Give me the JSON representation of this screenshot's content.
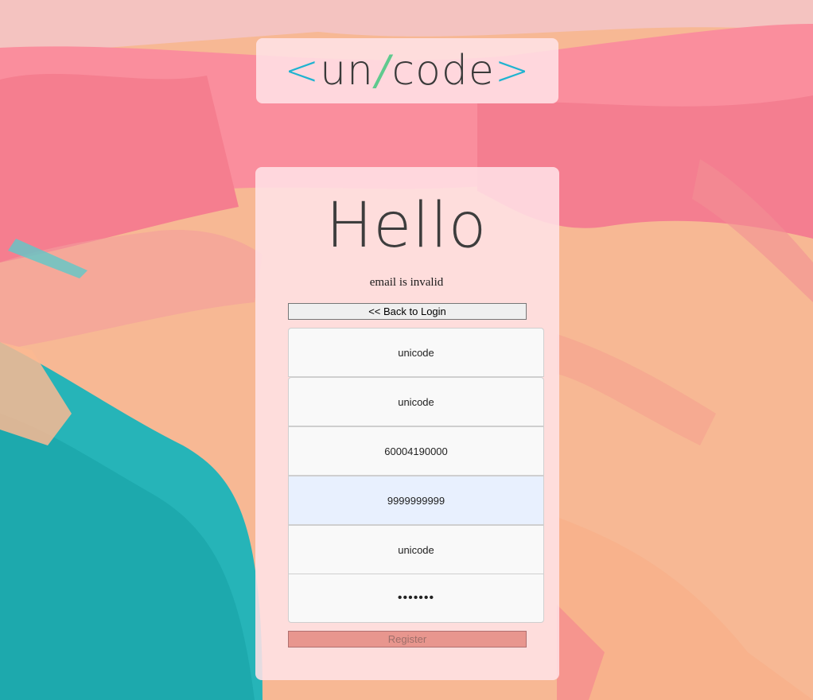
{
  "logo": {
    "open_bracket": "<",
    "text_before": "un",
    "slash": "/",
    "text_after": "code",
    "close_bracket": ">"
  },
  "heading": "Hello",
  "error_message": "email is invalid",
  "back_button_label": "<< Back to Login",
  "form": {
    "fields": [
      {
        "name": "field-1",
        "value": "unicode"
      },
      {
        "name": "field-2",
        "value": "unicode"
      },
      {
        "name": "field-3",
        "value": "60004190000"
      },
      {
        "name": "field-4",
        "value": "9999999999"
      },
      {
        "name": "field-5",
        "value": "unicode"
      },
      {
        "name": "field-6",
        "value": "•••••••"
      }
    ],
    "register_label": "Register"
  },
  "colors": {
    "logo_bracket": "#1fb3d0",
    "logo_slash": "#5fc98e",
    "register_button": "#e8968e",
    "autofill_field": "#e8f0fe"
  }
}
